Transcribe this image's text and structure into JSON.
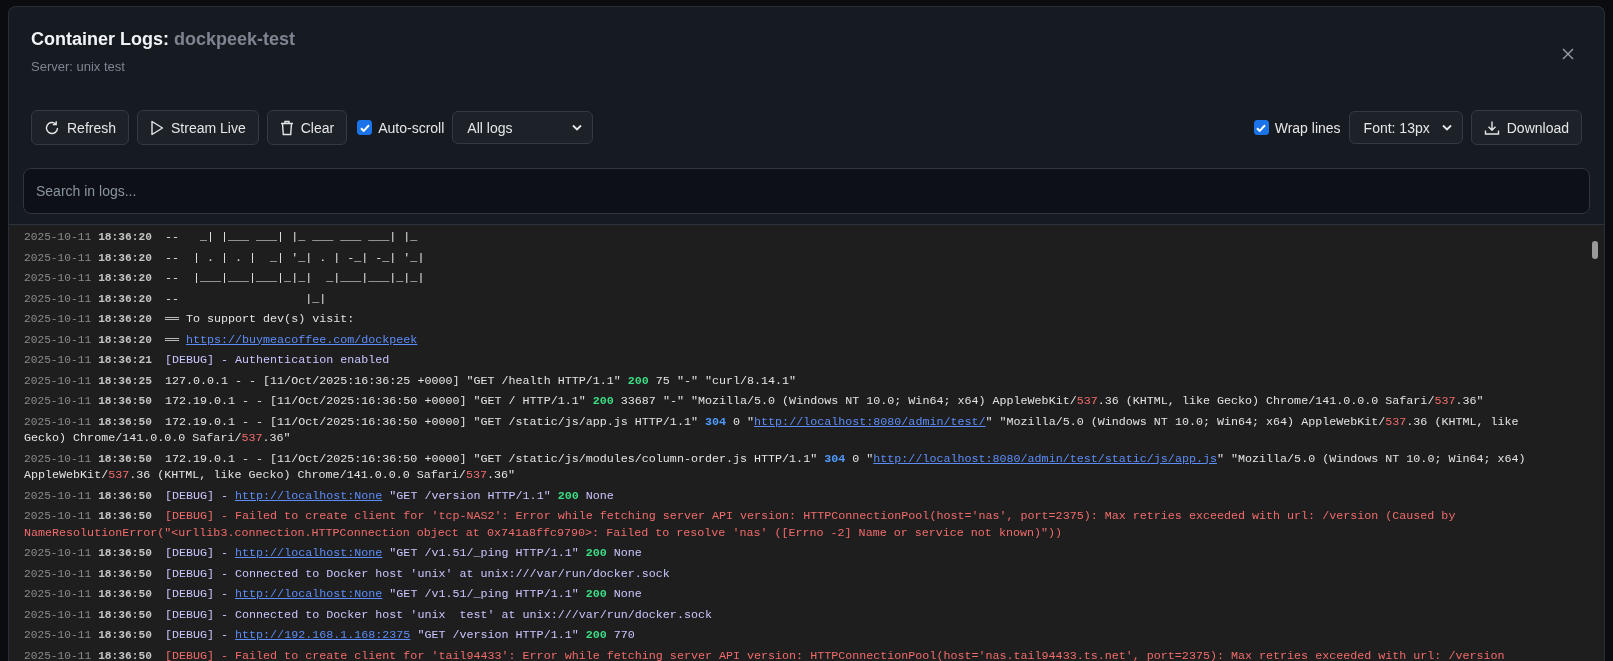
{
  "dialog": {
    "title": {
      "label": "Container Logs:",
      "name": "dockpeek-test"
    },
    "subtitle": "Server: unix test"
  },
  "toolbar": {
    "buttons": [
      {
        "label": "Refresh",
        "kind": "refresh"
      },
      {
        "label": "Stream Live",
        "kind": "stream"
      },
      {
        "label": "Clear",
        "kind": "clear"
      }
    ],
    "auto_scroll": {
      "label": "Auto-scroll",
      "checked": true
    },
    "filter": {
      "value": "All logs"
    },
    "wrap_lines": {
      "label": "Wrap lines",
      "checked": true
    },
    "font_size": {
      "value": "Font: 13px"
    },
    "download": {
      "label": "Download"
    }
  },
  "search": {
    "placeholder": "Search in logs..."
  },
  "logs": [
    {
      "date": "2025-10-11",
      "time": "18:36:20",
      "kind": "info",
      "parts": [
        {
          "kind": "text",
          "text": "--   _| |___ ___| |_ ___ ___ ___| |_"
        }
      ]
    },
    {
      "date": "2025-10-11",
      "time": "18:36:20",
      "kind": "info",
      "parts": [
        {
          "kind": "text",
          "text": "--  | . | . |  _| '_| . | -_| -_| '_|"
        }
      ]
    },
    {
      "date": "2025-10-11",
      "time": "18:36:20",
      "kind": "info",
      "parts": [
        {
          "kind": "text",
          "text": "--  |___|___|___|_|_|  _|___|___|_|_|"
        }
      ]
    },
    {
      "date": "2025-10-11",
      "time": "18:36:20",
      "kind": "info",
      "parts": [
        {
          "kind": "text",
          "text": "--                  |_|"
        }
      ]
    },
    {
      "date": "2025-10-11",
      "time": "18:36:20",
      "kind": "info",
      "parts": [
        {
          "kind": "text",
          "text": "══ To support dev(s) visit:"
        }
      ]
    },
    {
      "date": "2025-10-11",
      "time": "18:36:20",
      "kind": "info",
      "parts": [
        {
          "kind": "text",
          "text": "══ "
        },
        {
          "kind": "link",
          "text": "https://buymeacoffee.com/dockpeek"
        }
      ]
    },
    {
      "date": "2025-10-11",
      "time": "18:36:21",
      "kind": "debug",
      "parts": [
        {
          "kind": "text",
          "text": "[DEBUG] - Authentication enabled"
        }
      ]
    },
    {
      "date": "2025-10-11",
      "time": "18:36:25",
      "kind": "info",
      "parts": [
        {
          "kind": "text",
          "text": "127.0.0.1 - - [11/Oct/2025:16:36:25 +0000] \"GET /health HTTP/1.1\" "
        },
        {
          "kind": "success",
          "text": "200"
        },
        {
          "kind": "text",
          "text": " 75 \"-\" \"curl/8.14.1\""
        }
      ]
    },
    {
      "date": "2025-10-11",
      "time": "18:36:50",
      "kind": "info",
      "parts": [
        {
          "kind": "text",
          "text": "172.19.0.1 - - [11/Oct/2025:16:36:50 +0000] \"GET / HTTP/1.1\" "
        },
        {
          "kind": "success",
          "text": "200"
        },
        {
          "kind": "text",
          "text": " 33687 \"-\" \"Mozilla/5.0 (Windows NT 10.0; Win64; x64) AppleWebKit/"
        },
        {
          "kind": "highlight",
          "text": "537"
        },
        {
          "kind": "text",
          "text": ".36 (KHTML, like Gecko) Chrome/141.0.0.0 Safari/"
        },
        {
          "kind": "highlight",
          "text": "537"
        },
        {
          "kind": "text",
          "text": ".36\""
        }
      ]
    },
    {
      "date": "2025-10-11",
      "time": "18:36:50",
      "kind": "info",
      "parts": [
        {
          "kind": "text",
          "text": "172.19.0.1 - - [11/Oct/2025:16:36:50 +0000] \"GET /static/js/app.js HTTP/1.1\" "
        },
        {
          "kind": "redirect",
          "text": "304"
        },
        {
          "kind": "text",
          "text": " 0 \""
        },
        {
          "kind": "link",
          "text": "http://localhost:8080/admin/test/"
        },
        {
          "kind": "text",
          "text": "\" \"Mozilla/5.0 (Windows NT 10.0; Win64; x64) AppleWebKit/"
        },
        {
          "kind": "highlight",
          "text": "537"
        },
        {
          "kind": "text",
          "text": ".36 (KHTML, like Gecko) Chrome/141.0.0.0 Safari/"
        },
        {
          "kind": "highlight",
          "text": "537"
        },
        {
          "kind": "text",
          "text": ".36\""
        }
      ]
    },
    {
      "date": "2025-10-11",
      "time": "18:36:50",
      "kind": "info",
      "parts": [
        {
          "kind": "text",
          "text": "172.19.0.1 - - [11/Oct/2025:16:36:50 +0000] \"GET /static/js/modules/column-order.js HTTP/1.1\" "
        },
        {
          "kind": "redirect",
          "text": "304"
        },
        {
          "kind": "text",
          "text": " 0 \""
        },
        {
          "kind": "link",
          "text": "http://localhost:8080/admin/test/static/js/app.js"
        },
        {
          "kind": "text",
          "text": "\" \"Mozilla/5.0 (Windows NT 10.0; Win64; x64) AppleWebKit/"
        },
        {
          "kind": "highlight",
          "text": "537"
        },
        {
          "kind": "text",
          "text": ".36 (KHTML, like Gecko) Chrome/141.0.0.0 Safari/"
        },
        {
          "kind": "highlight",
          "text": "537"
        },
        {
          "kind": "text",
          "text": ".36\""
        }
      ]
    },
    {
      "date": "2025-10-11",
      "time": "18:36:50",
      "kind": "debug",
      "parts": [
        {
          "kind": "text",
          "text": "[DEBUG] - "
        },
        {
          "kind": "link",
          "text": "http://localhost:None"
        },
        {
          "kind": "text",
          "text": " \"GET /version HTTP/1.1\" "
        },
        {
          "kind": "success",
          "text": "200"
        },
        {
          "kind": "text",
          "text": " None"
        }
      ]
    },
    {
      "date": "2025-10-11",
      "time": "18:36:50",
      "kind": "error",
      "parts": [
        {
          "kind": "text",
          "text": "[DEBUG] - Failed to create client for 'tcp-NAS2': Error while fetching server API version: HTTPConnectionPool(host='nas', port=2375): Max retries exceeded with url: /version (Caused by NameResolutionError(\"<urllib3.connection.HTTPConnection object at 0x741a8ffc9790>: Failed to resolve 'nas' ([Errno -2] Name or service not known)\"))"
        }
      ]
    },
    {
      "date": "2025-10-11",
      "time": "18:36:50",
      "kind": "debug",
      "parts": [
        {
          "kind": "text",
          "text": "[DEBUG] - "
        },
        {
          "kind": "link",
          "text": "http://localhost:None"
        },
        {
          "kind": "text",
          "text": " \"GET /v1.51/_ping HTTP/1.1\" "
        },
        {
          "kind": "success",
          "text": "200"
        },
        {
          "kind": "text",
          "text": " None"
        }
      ]
    },
    {
      "date": "2025-10-11",
      "time": "18:36:50",
      "kind": "debug",
      "parts": [
        {
          "kind": "text",
          "text": "[DEBUG] - Connected to Docker host 'unix' at unix:///var/run/docker.sock"
        }
      ]
    },
    {
      "date": "2025-10-11",
      "time": "18:36:50",
      "kind": "debug",
      "parts": [
        {
          "kind": "text",
          "text": "[DEBUG] - "
        },
        {
          "kind": "link",
          "text": "http://localhost:None"
        },
        {
          "kind": "text",
          "text": " \"GET /v1.51/_ping HTTP/1.1\" "
        },
        {
          "kind": "success",
          "text": "200"
        },
        {
          "kind": "text",
          "text": " None"
        }
      ]
    },
    {
      "date": "2025-10-11",
      "time": "18:36:50",
      "kind": "debug",
      "parts": [
        {
          "kind": "text",
          "text": "[DEBUG] - Connected to Docker host 'unix  test' at unix:///var/run/docker.sock"
        }
      ]
    },
    {
      "date": "2025-10-11",
      "time": "18:36:50",
      "kind": "debug",
      "parts": [
        {
          "kind": "text",
          "text": "[DEBUG] - "
        },
        {
          "kind": "link",
          "text": "http://192.168.1.168:2375"
        },
        {
          "kind": "text",
          "text": " \"GET /version HTTP/1.1\" "
        },
        {
          "kind": "success",
          "text": "200"
        },
        {
          "kind": "text",
          "text": " 770"
        }
      ]
    },
    {
      "date": "2025-10-11",
      "time": "18:36:50",
      "kind": "error",
      "parts": [
        {
          "kind": "text",
          "text": "[DEBUG] - Failed to create client for 'tail94433': Error while fetching server API version: HTTPConnectionPool(host='nas.tail94433.ts.net', port=2375): Max retries exceeded with url: /version"
        }
      ]
    }
  ]
}
